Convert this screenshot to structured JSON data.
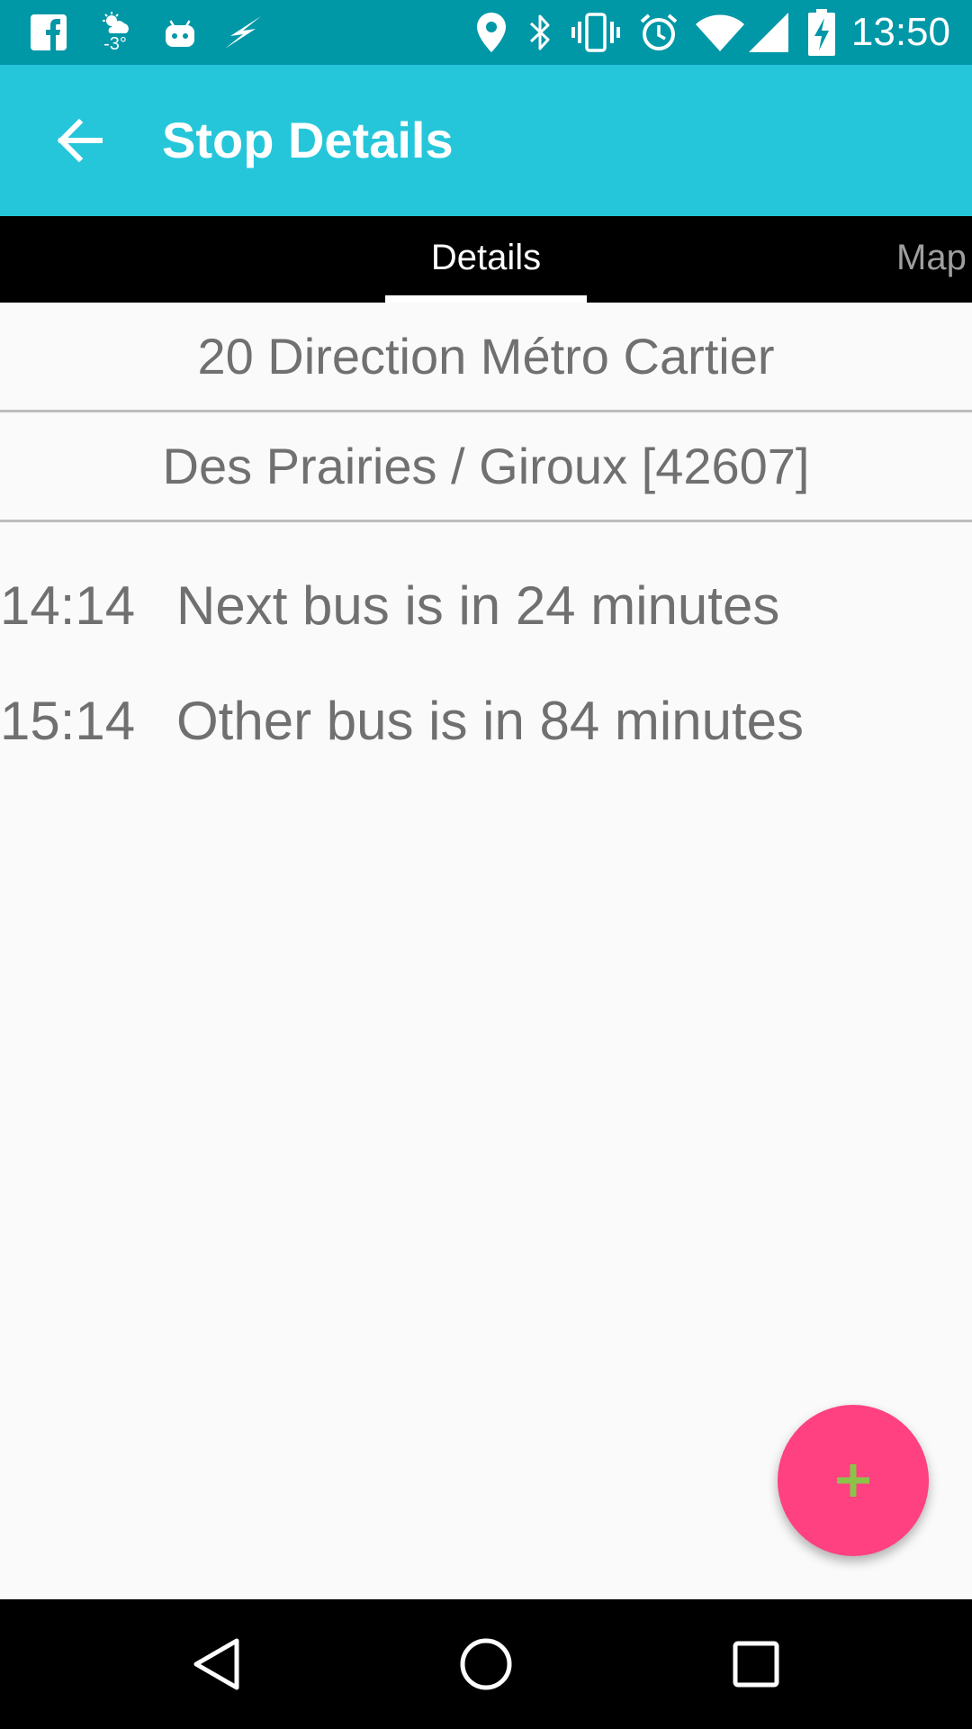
{
  "status_bar": {
    "time": "13:50",
    "weather_temp": "-3°",
    "left_icons": [
      "facebook-icon",
      "weather-icon",
      "android-icon",
      "bolt-icon"
    ],
    "right_icons": [
      "location-icon",
      "bluetooth-icon",
      "vibrate-icon",
      "alarm-icon",
      "wifi-icon",
      "signal-icon",
      "battery-charging-icon"
    ]
  },
  "app_bar": {
    "title": "Stop Details",
    "back_icon": "arrow-back-icon"
  },
  "tabs": [
    {
      "label": "Details",
      "selected": true
    },
    {
      "label": "Map",
      "selected": false
    }
  ],
  "route": {
    "name": "20 Direction Métro Cartier"
  },
  "stop": {
    "name": "Des Prairies / Giroux [42607]"
  },
  "arrivals": [
    {
      "time": "14:14",
      "text": "Next bus is in 24 minutes"
    },
    {
      "time": "15:14",
      "text": "Other bus is in 84 minutes"
    }
  ],
  "fab": {
    "icon": "plus-icon",
    "color": "#ff4081",
    "icon_color": "#8bc34a"
  },
  "nav_bar": {
    "icons": [
      "back-triangle-icon",
      "home-circle-icon",
      "recents-square-icon"
    ]
  },
  "colors": {
    "status_bar": "#0097a7",
    "app_bar": "#26c6da",
    "tab_bar": "#000000",
    "text": "#707070"
  }
}
